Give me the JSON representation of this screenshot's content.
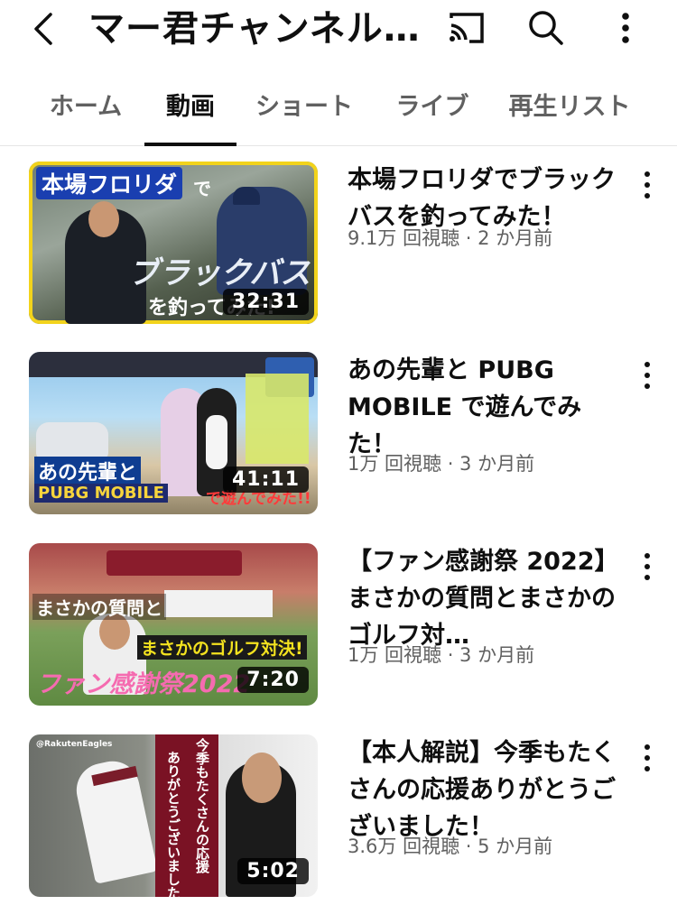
{
  "header": {
    "title": "マー君チャンネル…",
    "back_icon": "back-arrow-icon",
    "cast_icon": "cast-icon",
    "search_icon": "search-icon",
    "more_icon": "more-vert-icon"
  },
  "tabs": [
    {
      "label": "ホーム",
      "active": false
    },
    {
      "label": "動画",
      "active": true
    },
    {
      "label": "ショート",
      "active": false
    },
    {
      "label": "ライブ",
      "active": false
    },
    {
      "label": "再生リスト",
      "active": false
    }
  ],
  "videos": [
    {
      "title": "本場フロリダでブラックバスを釣ってみた！",
      "meta": "9.1万 回視聴 · 2 か月前",
      "duration": "32:31",
      "thumb_text": [
        "本場フロリダ",
        "で",
        "ブラックバス",
        "を釣ってみた!"
      ]
    },
    {
      "title": "あの先輩と PUBG MOBILE で遊んでみた！",
      "meta": "1万 回視聴 · 3 か月前",
      "duration": "41:11",
      "thumb_text": [
        "あの先輩と",
        "PUBG MOBILE",
        "で遊んでみた!!"
      ]
    },
    {
      "title": "【ファン感謝祭 2022】まさかの質問とまさかのゴルフ対…",
      "meta": "1万 回視聴 · 3 か月前",
      "duration": "7:20",
      "thumb_text": [
        "まさかの質問と",
        "まさかのゴルフ対決!",
        "ファン感謝祭2022"
      ]
    },
    {
      "title": "【本人解説】今季もたくさんの応援ありがとうございました！",
      "meta": "3.6万 回視聴 · 5 か月前",
      "duration": "5:02",
      "thumb_text": [
        "今季もたくさんの応援",
        "ありがとうございました!",
        "@RakutenEagles"
      ]
    }
  ]
}
